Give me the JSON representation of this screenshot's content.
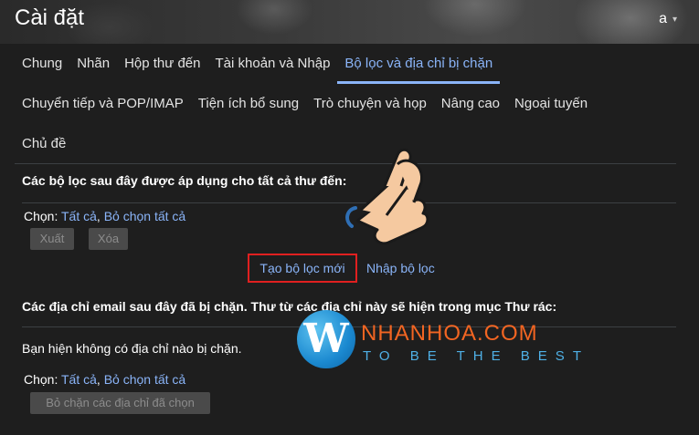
{
  "header": {
    "title": "Cài đặt",
    "account_initial": "a",
    "account_caret": "▾"
  },
  "tabs": {
    "row1": [
      {
        "label": "Chung"
      },
      {
        "label": "Nhãn"
      },
      {
        "label": "Hộp thư đến"
      },
      {
        "label": "Tài khoản và Nhập"
      },
      {
        "label": "Bộ lọc và địa chỉ bị chặn",
        "active": true
      }
    ],
    "row2": [
      {
        "label": "Chuyển tiếp và POP/IMAP"
      },
      {
        "label": "Tiện ích bổ sung"
      },
      {
        "label": "Trò chuyện và họp"
      },
      {
        "label": "Nâng cao"
      },
      {
        "label": "Ngoại tuyến"
      }
    ],
    "row3": [
      {
        "label": "Chủ đề"
      }
    ]
  },
  "filters": {
    "heading": "Các bộ lọc sau đây được áp dụng cho tất cả thư đến:",
    "select_label": "Chọn: ",
    "select_all": "Tất cả",
    "separator": ", ",
    "deselect_all": "Bỏ chọn tất cả",
    "export_button": "Xuất",
    "delete_button": "Xóa",
    "create_filter": "Tạo bộ lọc mới",
    "import_filter": "Nhập bộ lọc"
  },
  "blocked": {
    "heading": "Các địa chỉ email sau đây đã bị chặn. Thư từ các địa chỉ này sẽ hiện trong mục Thư rác:",
    "empty_message": "Bạn hiện không có địa chỉ nào bị chặn.",
    "select_label": "Chọn: ",
    "select_all": "Tất cả",
    "separator": ", ",
    "deselect_all": "Bỏ chọn tất cả",
    "unblock_button": "Bỏ chặn các địa chỉ đã chọn"
  },
  "watermark": {
    "logo_letter": "W",
    "name": "NHANHOA.COM",
    "slogan": "TO BE THE BEST"
  },
  "colors": {
    "accent": "#8ab4f8",
    "highlight_box": "#e02020",
    "background": "#1e1e1e"
  }
}
